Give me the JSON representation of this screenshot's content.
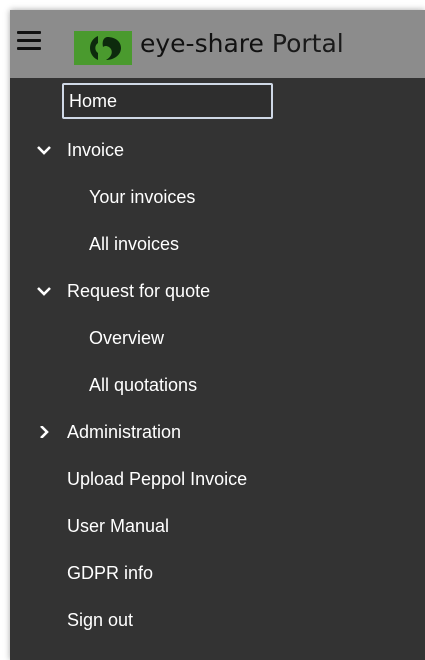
{
  "header": {
    "brand_name": "eye-share",
    "brand_suffix": "Portal",
    "icons": {
      "menu": "hamburger-menu-icon",
      "logo": "eye-share-logo-icon"
    },
    "colors": {
      "header_bg": "#8c8c8c",
      "logo_green": "#4a9a2e",
      "nav_bg": "#333333"
    }
  },
  "nav": {
    "home": "Home",
    "invoice": "Invoice",
    "your_invoices": "Your invoices",
    "all_invoices": "All invoices",
    "request_for_quote": "Request for quote",
    "overview": "Overview",
    "all_quotations": "All quotations",
    "administration": "Administration",
    "upload_peppol": "Upload Peppol Invoice",
    "user_manual": "User Manual",
    "gdpr_info": "GDPR info",
    "sign_out": "Sign out"
  }
}
